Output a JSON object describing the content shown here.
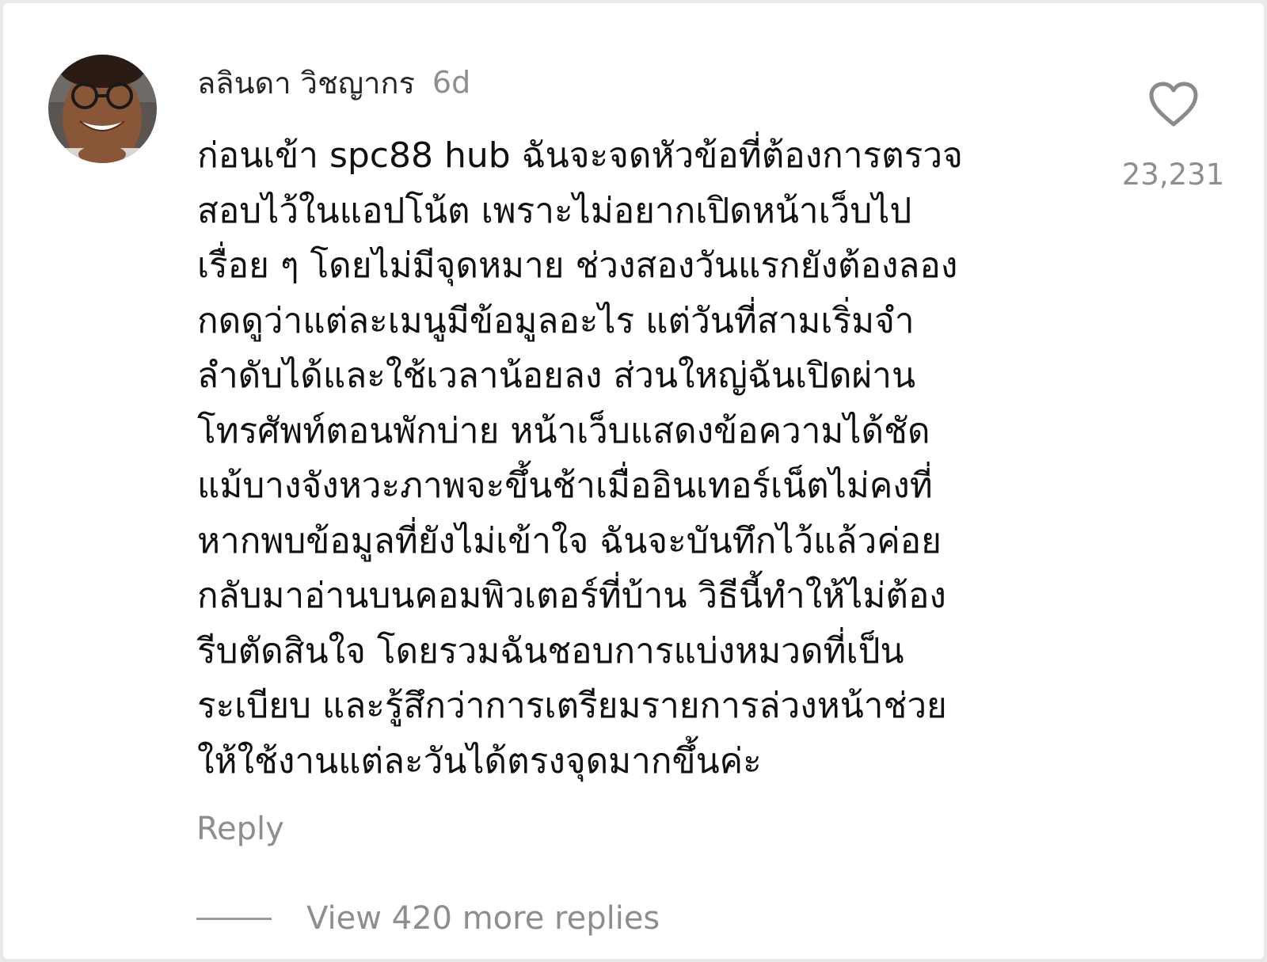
{
  "comment": {
    "author": "ลลินดา วิชญากร",
    "time": "6d",
    "body_lines": [
      "ก่อนเข้า spc88 hub ฉันจะจดหัวข้อที่ต้องการตรวจ",
      "สอบไว้ในแอปโน้ต เพราะไม่อยากเปิดหน้าเว็บไป",
      "เรื่อย ๆ โดยไม่มีจุดหมาย ช่วงสองวันแรกยังต้องลอง",
      "กดดูว่าแต่ละเมนูมีข้อมูลอะไร แต่วันที่สามเริ่มจำ",
      "ลำดับได้และใช้เวลาน้อยลง ส่วนใหญ่ฉันเปิดผ่าน",
      "โทรศัพท์ตอนพักบ่าย หน้าเว็บแสดงข้อความได้ชัด",
      "แม้บางจังหวะภาพจะขึ้นช้าเมื่ออินเทอร์เน็ตไม่คงที่",
      "หากพบข้อมูลที่ยังไม่เข้าใจ ฉันจะบันทึกไว้แล้วค่อย",
      "กลับมาอ่านบนคอมพิวเตอร์ที่บ้าน วิธีนี้ทำให้ไม่ต้อง",
      "รีบตัดสินใจ โดยรวมฉันชอบการแบ่งหมวดที่เป็น",
      "ระเบียบ และรู้สึกว่าการเตรียมรายการล่วงหน้าช่วย",
      "ให้ใช้งานแต่ละวันได้ตรงจุดมากขึ้นค่ะ"
    ],
    "like_icon": "heart-outline-icon",
    "like_count": "23,231",
    "reply_label": "Reply",
    "view_replies_label": "View 420 more replies"
  },
  "colors": {
    "primary_text": "#111111",
    "secondary_text": "#8e8e8e",
    "background": "#ffffff"
  }
}
